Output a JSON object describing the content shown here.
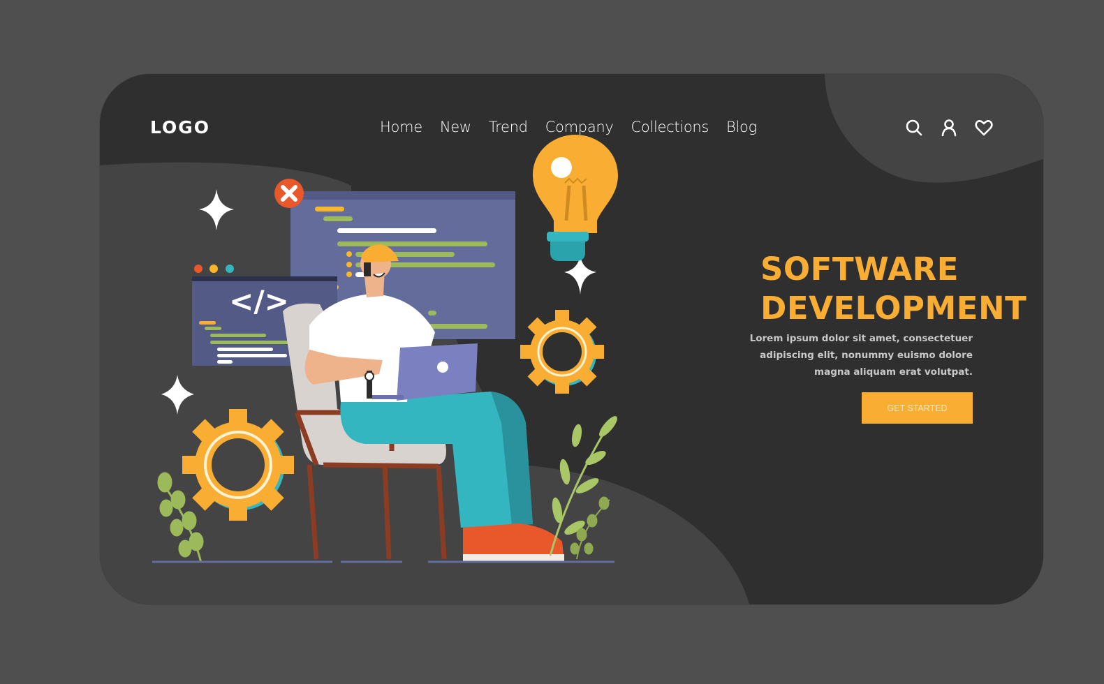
{
  "header": {
    "logo": "LOGO",
    "nav": [
      {
        "label": "Home"
      },
      {
        "label": "New"
      },
      {
        "label": "Trend"
      },
      {
        "label": "Company"
      },
      {
        "label": "Collections"
      },
      {
        "label": "Blog"
      }
    ],
    "icons": [
      "search-icon",
      "user-icon",
      "heart-icon"
    ]
  },
  "hero": {
    "title_line1": "SOFTWARE",
    "title_line2": "DEVELOPMENT",
    "description_lines": [
      "Lorem ipsum dolor sit amet, consectetuer",
      "adipiscing elit, nonummy euismo dolore",
      "magna aliquam erat volutpat."
    ],
    "cta_label": "GET STARTED"
  },
  "illustration": {
    "subject": "developer sitting in chair with laptop",
    "code_symbol": "</>"
  },
  "colors": {
    "page_bg": "#4f4f4f",
    "card_bg": "#2f2f2f",
    "blob": "#444444",
    "accent": "#f9ad33",
    "window": "#646c9c",
    "teal": "#34b6c0",
    "red": "#e8582a",
    "leaf": "#9cba5a"
  }
}
